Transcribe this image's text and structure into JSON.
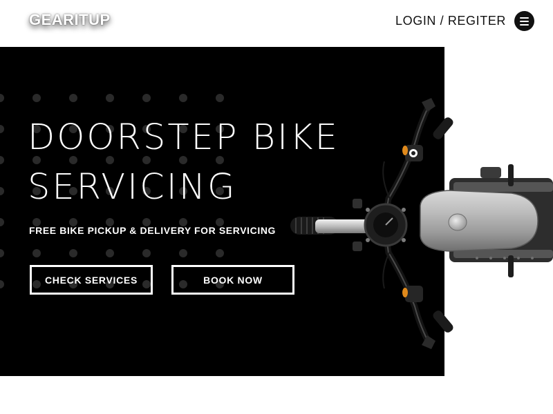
{
  "header": {
    "logo": "GEARITUP",
    "login_link": "LOGIN / REGITER",
    "menu_icon": "hamburger-menu-icon"
  },
  "hero": {
    "title_line1": "DOORSTEP BIKE",
    "title_line2": "SERVICING",
    "subtitle": "FREE BIKE PICKUP & DELIVERY FOR SERVICING",
    "buttons": {
      "check_services": "CHECK SERVICES",
      "book_now": "BOOK NOW"
    },
    "image": "motorcycle-top-view"
  },
  "colors": {
    "hero_background": "#000000",
    "page_background": "#ffffff",
    "text_light": "#ffffff",
    "text_dark": "#111111",
    "dot_pattern": "#2a2a2a"
  }
}
